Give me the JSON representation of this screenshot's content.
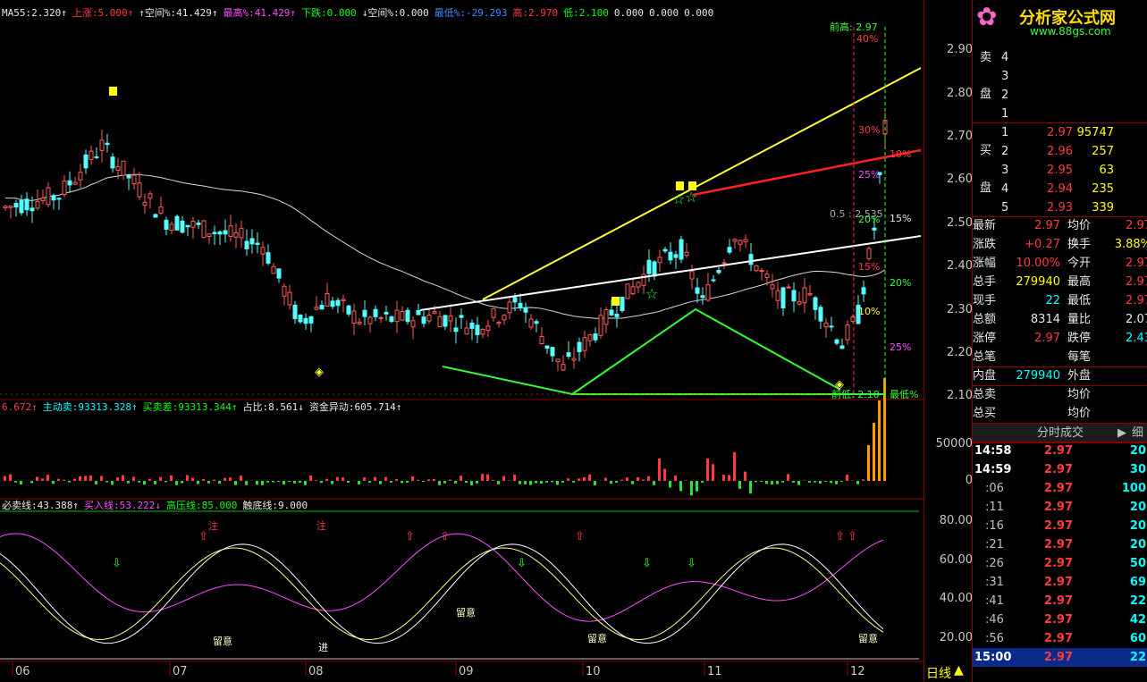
{
  "header_top": {
    "items": [
      {
        "label": "MA55:",
        "value": "2.320",
        "arrow": "↑",
        "color": "#e8e8e8"
      },
      {
        "label": "上涨:",
        "value": "5.000",
        "arrow": "↑",
        "color": "#ff3b3b"
      },
      {
        "label": "↑空间%:",
        "value": "41.429",
        "arrow": "↑",
        "color": "#e8e8e8"
      },
      {
        "label": "最高%:",
        "value": "41.429",
        "arrow": "↑",
        "color": "#ff4cff"
      },
      {
        "label": "下跌:",
        "value": "0.000",
        "arrow": "",
        "color": "#00ff00"
      },
      {
        "label": "↓空间%:",
        "value": "0.000",
        "arrow": "",
        "color": "#e8e8e8"
      },
      {
        "label": "最低%:",
        "value": "-29.293",
        "arrow": "",
        "color": "#3c8cff"
      },
      {
        "label": "高:",
        "value": "2.970",
        "arrow": "",
        "color": "#ff3b3b"
      },
      {
        "label": "低:",
        "value": "2.100",
        "arrow": "",
        "color": "#00ff00"
      },
      {
        "label": "",
        "value": "0.000",
        "arrow": "",
        "color": "#e8e8e8"
      },
      {
        "label": "",
        "value": "0.000",
        "arrow": "",
        "color": "#e8e8e8"
      },
      {
        "label": "",
        "value": "0.000",
        "arrow": "",
        "color": "#e8e8e8"
      }
    ]
  },
  "header_volume": {
    "items": [
      {
        "label": "",
        "value": "6.672",
        "arrow": "↑",
        "color": "#ff3b3b"
      },
      {
        "label": "主动卖:",
        "value": "93313.328",
        "arrow": "↑",
        "color": "#00ffff"
      },
      {
        "label": "买卖差:",
        "value": "93313.344",
        "arrow": "↑",
        "color": "#00ff00"
      },
      {
        "label": "占比:",
        "value": "8.561",
        "arrow": "↓",
        "color": "#e8e8e8"
      },
      {
        "label": "资金异动:",
        "value": "605.714",
        "arrow": "↑",
        "color": "#e8e8e8"
      }
    ]
  },
  "header_indicator": {
    "items": [
      {
        "label": "必卖线:",
        "value": "43.388",
        "arrow": "↑",
        "color": "#e8e8e8"
      },
      {
        "label": "买入线:",
        "value": "53.222",
        "arrow": "↓",
        "color": "#ff4cff"
      },
      {
        "label": "高压线:",
        "value": "85.000",
        "arrow": "",
        "color": "#00ff00"
      },
      {
        "label": "触底线:",
        "value": "9.000",
        "arrow": "",
        "color": "#e8e8e8"
      }
    ]
  },
  "price_axis": [
    "2.90",
    "2.80",
    "2.70",
    "2.60",
    "2.50",
    "2.40",
    "2.30",
    "2.20",
    "2.10"
  ],
  "volume_axis": [
    "50000",
    "0"
  ],
  "indicator_axis": [
    "80.00",
    "60.00",
    "40.00",
    "20.00"
  ],
  "month_labels": [
    "06",
    "07",
    "08",
    "09",
    "10",
    "11",
    "12"
  ],
  "period_label": "日线",
  "chart_annotations": {
    "high_label": "前高: 2.97",
    "pct_40": "40%",
    "pct_30": "30%",
    "pct_25": "25%",
    "pct_20": "20%",
    "pct_15": "15%",
    "pct_10": "10%",
    "pct_r10": "10%",
    "pct_r15": "15%",
    "pct_r20": "20%",
    "pct_r25": "25%",
    "mid_label": "0.5 : 2.535",
    "low_label": "前低: 2.10",
    "min_pct": "最低%",
    "mark_liuyi_1": "留意",
    "mark_liuyi_2": "留意",
    "mark_liuyi_3": "留意",
    "mark_liuyi_4": "留意",
    "mark_jin": "进",
    "mark_zhu_1": "注",
    "mark_zhu_2": "注"
  },
  "logo": {
    "title": "分析家公式网",
    "url": "www.88gs.com"
  },
  "order_book": {
    "sell_label_1": "卖",
    "sell_label_2": "盘",
    "buy_label_1": "买",
    "buy_label_2": "盘",
    "sells": [
      {
        "level": "4",
        "price": "",
        "vol": ""
      },
      {
        "level": "3",
        "price": "",
        "vol": ""
      },
      {
        "level": "2",
        "price": "",
        "vol": ""
      },
      {
        "level": "1",
        "price": "",
        "vol": ""
      }
    ],
    "buys": [
      {
        "level": "1",
        "price": "2.97",
        "vol": "95747"
      },
      {
        "level": "2",
        "price": "2.96",
        "vol": "257"
      },
      {
        "level": "3",
        "price": "2.95",
        "vol": "63"
      },
      {
        "level": "4",
        "price": "2.94",
        "vol": "235"
      },
      {
        "level": "5",
        "price": "2.93",
        "vol": "339"
      }
    ]
  },
  "quote_stats": [
    {
      "l": "最新",
      "v": "2.97",
      "vc": "#ff3b3b",
      "l2": "均价",
      "v2": "2.97",
      "vc2": "#ff3b3b"
    },
    {
      "l": "涨跌",
      "v": "+0.27",
      "vc": "#ff3b3b",
      "l2": "换手",
      "v2": "3.88%",
      "vc2": "#ffff00"
    },
    {
      "l": "涨幅",
      "v": "10.00%",
      "vc": "#ff3b3b",
      "l2": "今开",
      "v2": "2.97",
      "vc2": "#ff3b3b"
    },
    {
      "l": "总手",
      "v": "279940",
      "vc": "#ffff00",
      "l2": "最高",
      "v2": "2.97",
      "vc2": "#ff3b3b"
    },
    {
      "l": "现手",
      "v": "22",
      "vc": "#00ffff",
      "l2": "最低",
      "v2": "2.97",
      "vc2": "#ff3b3b"
    },
    {
      "l": "总额",
      "v": "8314",
      "vc": "#e8e8e8",
      "l2": "量比",
      "v2": "2.07",
      "vc2": "#e8e8e8"
    },
    {
      "l": "涨停",
      "v": "2.97",
      "vc": "#ff3b3b",
      "l2": "跌停",
      "v2": "2.43",
      "vc2": "#00ffff"
    },
    {
      "l": "总笔",
      "v": "",
      "vc": "#e8e8e8",
      "l2": "每笔",
      "v2": "",
      "vc2": "#e8e8e8"
    },
    {
      "l": "内盘",
      "v": "279940",
      "vc": "#00ffff",
      "l2": "外盘",
      "v2": "",
      "vc2": "#e8e8e8"
    },
    {
      "l": "总卖",
      "v": "",
      "vc": "#e8e8e8",
      "l2": "均价",
      "v2": "",
      "vc2": "#e8e8e8"
    },
    {
      "l": "总买",
      "v": "",
      "vc": "#e8e8e8",
      "l2": "均价",
      "v2": "",
      "vc2": "#e8e8e8"
    }
  ],
  "tick_header": {
    "title": "分时成交",
    "play": "▶",
    "detail": "细"
  },
  "ticks": [
    {
      "t": "14:58",
      "p": "2.97",
      "v": "20"
    },
    {
      "t": "14:59",
      "p": "2.97",
      "v": "30"
    },
    {
      "t": ":06",
      "p": "2.97",
      "v": "100"
    },
    {
      "t": ":11",
      "p": "2.97",
      "v": "20"
    },
    {
      "t": ":16",
      "p": "2.97",
      "v": "20"
    },
    {
      "t": ":21",
      "p": "2.97",
      "v": "20"
    },
    {
      "t": ":26",
      "p": "2.97",
      "v": "50"
    },
    {
      "t": ":31",
      "p": "2.97",
      "v": "69"
    },
    {
      "t": ":41",
      "p": "2.97",
      "v": "22"
    },
    {
      "t": ":46",
      "p": "2.97",
      "v": "42"
    },
    {
      "t": ":56",
      "p": "2.97",
      "v": "60"
    },
    {
      "t": "15:00",
      "p": "2.97",
      "v": "22"
    }
  ],
  "chart_data": {
    "type": "candlestick",
    "price_range": [
      2.08,
      2.99
    ],
    "months": [
      "06",
      "07",
      "08",
      "09",
      "10",
      "11",
      "12"
    ],
    "ma55_last": 2.32,
    "high": 2.97,
    "low": 2.1,
    "indicator_range": [
      10,
      90
    ],
    "indicator_lines": {
      "sell_line": 43.388,
      "buy_line": 53.222,
      "pressure_line": 85.0,
      "bottom_line": 9.0
    }
  }
}
